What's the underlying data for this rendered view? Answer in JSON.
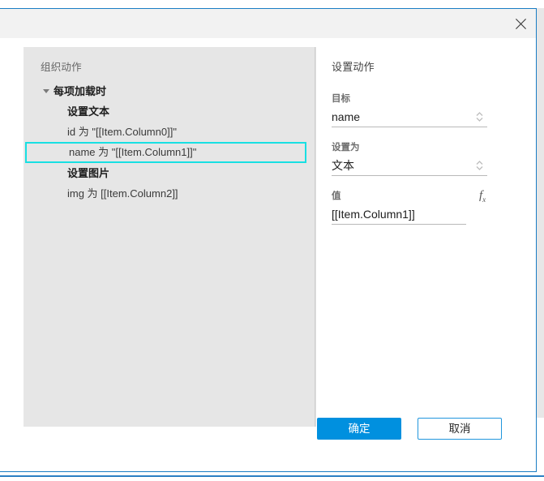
{
  "dialog": {
    "close_icon": "close-icon",
    "left_panel": {
      "heading": "组织动作",
      "tree": [
        {
          "level": "root",
          "label": "每项加载时",
          "expanded": true,
          "selected": false
        },
        {
          "level": "group",
          "label": "设置文本",
          "expanded": null,
          "selected": false
        },
        {
          "level": "leaf",
          "label": "id 为 \"[[Item.Column0]]\"",
          "expanded": null,
          "selected": false
        },
        {
          "level": "leaf",
          "label": "name 为 \"[[Item.Column1]]\"",
          "expanded": null,
          "selected": true
        },
        {
          "level": "group",
          "label": "设置图片",
          "expanded": null,
          "selected": false
        },
        {
          "level": "leaf",
          "label": "img 为 [[Item.Column2]]",
          "expanded": null,
          "selected": false
        }
      ]
    },
    "right_panel": {
      "heading": "设置动作",
      "fields": [
        {
          "label": "目标",
          "value": "name",
          "control": "combo",
          "icon": "spinner-updown-icon"
        },
        {
          "label": "设置为",
          "value": "文本",
          "control": "combo",
          "icon": "spinner-updown-icon"
        },
        {
          "label": "值",
          "value": "[[Item.Column1]]",
          "control": "valuebox",
          "icon": "fx-icon"
        }
      ]
    },
    "footer": {
      "ok_label": "确定",
      "cancel_label": "取消"
    }
  },
  "backdrop": {
    "search_icon": "search-icon"
  },
  "colors": {
    "dialog_border": "#1a7dc4",
    "primary_button": "#0090df",
    "selection_outline": "#18dfe2",
    "panel_gray": "#e6e6e6",
    "titlebar_gray": "#f2f2f2"
  }
}
